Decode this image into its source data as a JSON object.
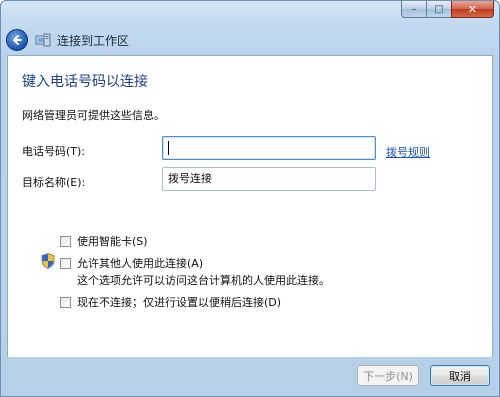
{
  "window": {
    "caption_buttons": {
      "minimize_symbol": "–",
      "maximize_symbol": "□",
      "close_symbol": "✕"
    }
  },
  "nav": {
    "title": "连接到工作区",
    "back_icon": "back-arrow-icon",
    "app_icon": "network-workplace-icon"
  },
  "main": {
    "heading": "键入电话号码以连接",
    "subtext": "网络管理员可提供这些信息。",
    "phone_label": "电话号码(T):",
    "phone_value": "",
    "dialing_rules_link": "拨号规则",
    "dest_label": "目标名称(E):",
    "dest_value": "拨号连接",
    "options": {
      "smart_card": {
        "label": "使用智能卡(S)",
        "checked": false
      },
      "allow_others": {
        "label": "允许其他人使用此连接(A)",
        "checked": false,
        "hint": "这个选项允许可以访问这台计算机的人使用此连接。",
        "icon": "uac-shield-icon"
      },
      "connect_later": {
        "label": "现在不连接；仅进行设置以便稍后连接(D)",
        "checked": false
      }
    }
  },
  "footer": {
    "next_label": "下一步(N)",
    "next_enabled": false,
    "cancel_label": "取消"
  },
  "colors": {
    "heading": "#1e3e8f",
    "link": "#1e4fb3",
    "frame": "#b9d2ec"
  }
}
